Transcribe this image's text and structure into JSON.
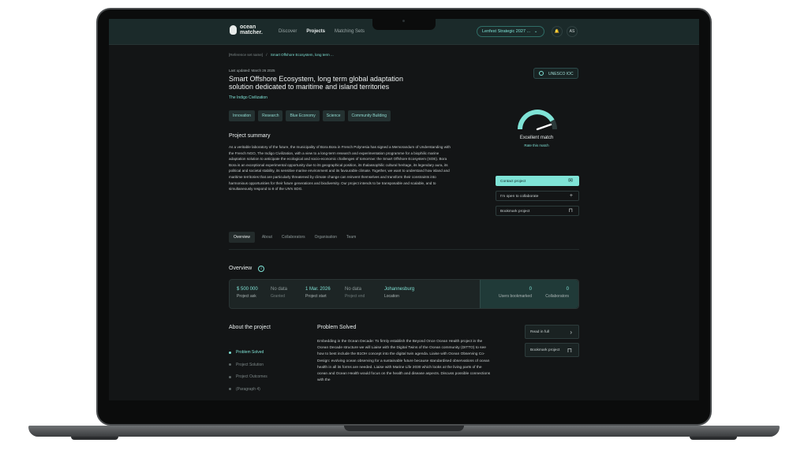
{
  "app": {
    "logo_text": "ocean\nmatcher.",
    "nav": [
      "Discover",
      "Projects",
      "Matching Sets"
    ],
    "org_selector": "Lenfest Strategic 2027 ...",
    "avatar_initials": "AS"
  },
  "breadcrumb": {
    "parent": "[Reference set name]",
    "separator": "/",
    "current": "Smart Offshore Ecosystem, long term ..."
  },
  "project": {
    "last_updated": "Last updated: March 26 2025",
    "title": "Smart Offshore Ecosystem, long term global adaptation solution dedicated to maritime and island territories",
    "organisation": "The Indigo Civilization",
    "badge": "UNESCO IOC",
    "tags": [
      "Innovation",
      "Research",
      "Blue Economy",
      "Science",
      "Community Building"
    ]
  },
  "match": {
    "label": "Excellent match",
    "rate_link": "Rate this match",
    "level": 0.85
  },
  "summary": {
    "heading": "Project summary",
    "text": "As a veritable laboratory of the future, the municipality of Bora Bora in French Polynesia has signed a Memorandum of Understanding with the French NGO, The Indigo Civilization, with a view to a long-term research and experimentation programme for a biophilic marine adaptation solution to anticipate the ecological and socio-economic challenges of tomorrow: the Smart Offshore Ecosystem (SOE). Bora Bora is an exceptional experimental opportunity due to its geographical position, its thalassophilic cultural heritage, its legendary aura, its political and societal stability, its sensitive marine environment and its favourable climate. Together, we want to understand how island and maritime territories that are particularly threatened by climate change can reinvent themselves and transform their constraints into harmonious opportunities for their future generations and biodiversity. Our project intends to be transposable and scalable, and to simultaneously respond to 8 of the UN's SDG."
  },
  "actions": {
    "contact": "Contact project",
    "collaborate": "I'm open to collaborate",
    "bookmark": "Bookmark project"
  },
  "tabs": [
    "Overview",
    "About",
    "Collaborators",
    "Organisation",
    "Team"
  ],
  "overview": {
    "heading": "Overview",
    "stats": [
      {
        "value": "$ 500 000",
        "label": "Project ask"
      },
      {
        "value": "No data",
        "label": "Granted"
      },
      {
        "value": "1 Mar. 2026",
        "label": "Project start"
      },
      {
        "value": "No data",
        "label": "Project end"
      },
      {
        "value": "Johannesburg",
        "label": "Location"
      }
    ],
    "users_bookmarked": {
      "value": "0",
      "label": "Users bookmarked"
    },
    "collaborators": {
      "value": "0",
      "label": "Collaborators"
    }
  },
  "about": {
    "heading": "About the project",
    "toc": [
      "Problem Solved",
      "Project Solution",
      "Project Outcomes",
      "(Paragraph 4)"
    ],
    "section_heading": "Problem Solved",
    "section_text": "Embedding in the Ocean Decade: To firmly establish the Beyond Once Ocean Health project in the Ocean Decade structure we will Liaise with the Digital Twins of the Ocean community (DITTO) to see how to best include the B1OH concept into the digital twin agenda. Liaise with Ocean Observing Co-Design: evolving ocean observing for a sustainable future because standardised observations of ocean health in all its forms are needed. Liaise with Marine Life 2030 which looks at the living parts of the ocean and Ocean Health would focus on the health and disease aspects. Discuss possible connections with the",
    "read_full": "Read in full",
    "bookmark": "Bookmark project"
  },
  "colors": {
    "accent": "#7fe3d6",
    "background": "#131516",
    "topbar": "#1b2a2a"
  }
}
